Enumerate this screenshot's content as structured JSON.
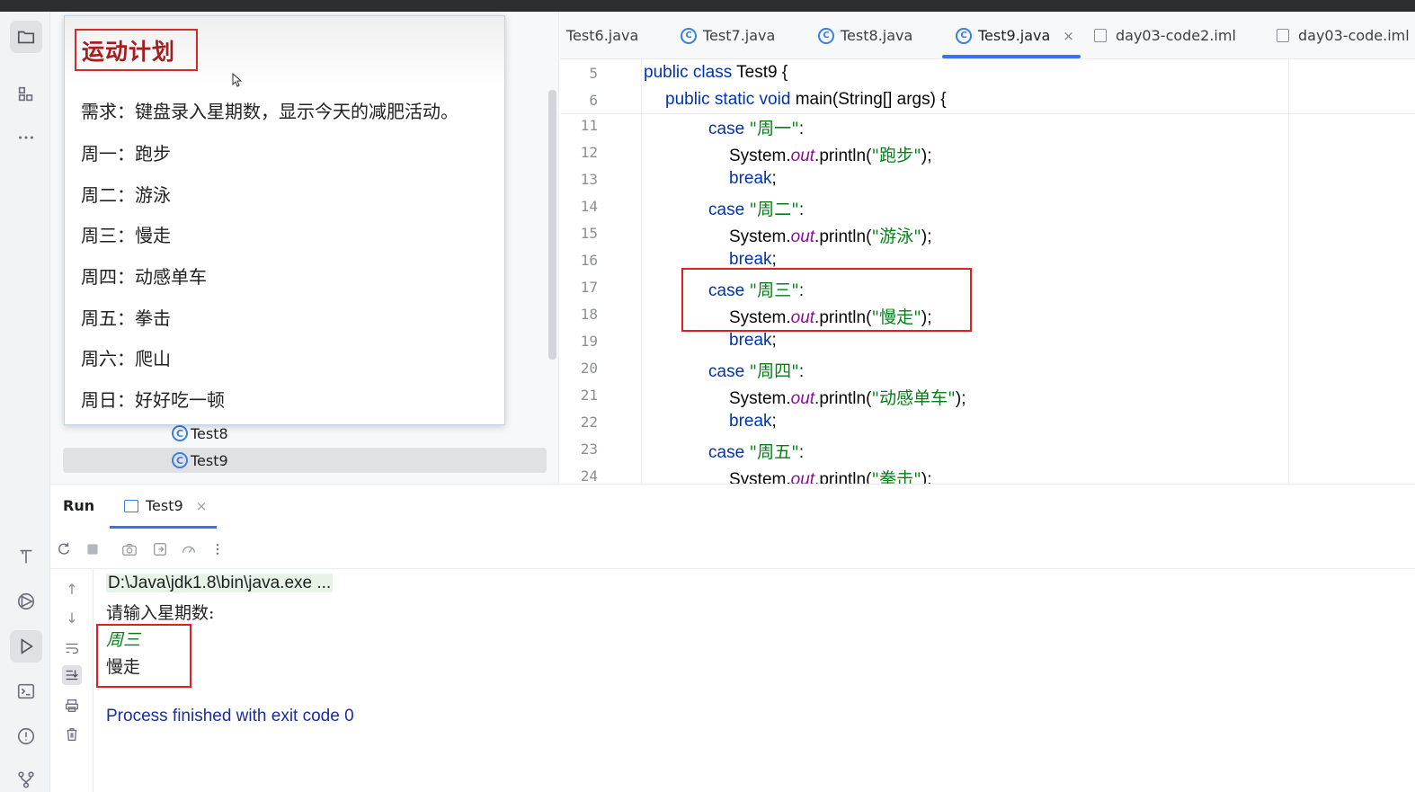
{
  "popup": {
    "title": "运动计划",
    "lines": [
      "需求：键盘录入星期数，显示今天的减肥活动。",
      "周一：跑步",
      "周二：游泳",
      "周三：慢走",
      "周四：动感单车",
      "周五：拳击",
      "周六：爬山",
      "周日：好好吃一顿"
    ]
  },
  "project_tree": {
    "items": [
      {
        "label": "Test8",
        "selected": false
      },
      {
        "label": "Test9",
        "selected": true
      }
    ]
  },
  "editor_tabs": [
    {
      "label": "Test6.java",
      "icon": "none"
    },
    {
      "label": "Test7.java",
      "icon": "java-class-icon"
    },
    {
      "label": "Test8.java",
      "icon": "java-class-icon"
    },
    {
      "label": "Test9.java",
      "icon": "java-class-icon",
      "active": true,
      "close": "×"
    },
    {
      "label": "day03-code2.iml",
      "icon": "module-file-icon"
    },
    {
      "label": "day03-code.iml",
      "icon": "module-file-icon"
    }
  ],
  "code": {
    "sticky": [
      {
        "num": "5",
        "parts": [
          [
            "kw",
            "public class "
          ],
          [
            "",
            "Test9 {"
          ]
        ]
      },
      {
        "num": "6",
        "parts": [
          [
            "kw",
            "public static void "
          ],
          [
            "",
            "main(String[] args) {"
          ]
        ]
      }
    ],
    "lines": [
      {
        "num": "11",
        "kw": "case ",
        "str": "\"周一\"",
        "tail": ":"
      },
      {
        "num": "12",
        "print": "\"跑步\""
      },
      {
        "num": "13",
        "brk": "break"
      },
      {
        "num": "14",
        "kw": "case ",
        "str": "\"周二\"",
        "tail": ":"
      },
      {
        "num": "15",
        "print": "\"游泳\""
      },
      {
        "num": "16",
        "brk": "break"
      },
      {
        "num": "17",
        "kw": "case ",
        "str": "\"周三\"",
        "tail": ":"
      },
      {
        "num": "18",
        "print": "\"慢走\""
      },
      {
        "num": "19",
        "brk": "break"
      },
      {
        "num": "20",
        "kw": "case ",
        "str": "\"周四\"",
        "tail": ":"
      },
      {
        "num": "21",
        "print": "\"动感单车\""
      },
      {
        "num": "22",
        "brk": "break"
      },
      {
        "num": "23",
        "kw": "case ",
        "str": "\"周五\"",
        "tail": ":"
      },
      {
        "num": "24",
        "print": "\"拳击\""
      }
    ]
  },
  "run": {
    "title": "Run",
    "tab_label": "Test9",
    "tab_close": "×",
    "console": {
      "command": "D:\\Java\\jdk1.8\\bin\\java.exe ...",
      "prompt": "请输入星期数:",
      "input": "周三",
      "output": "慢走",
      "finish": "Process finished with exit code 0"
    }
  },
  "colors": {
    "keyword": "#0033b3",
    "string": "#067d17",
    "field": "#871094",
    "highlight_box": "#e02020",
    "accent": "#3874f0"
  }
}
